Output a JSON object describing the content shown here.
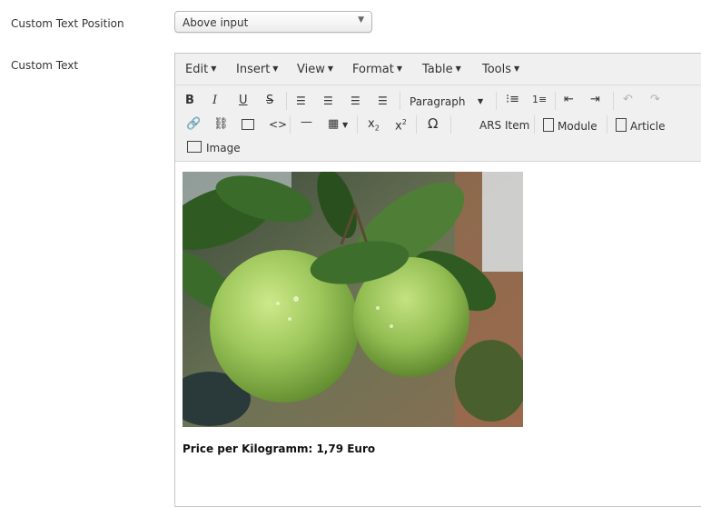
{
  "fields": {
    "position_label": "Custom Text Position",
    "position_value": "Above input",
    "text_label": "Custom Text"
  },
  "editor": {
    "menus": [
      "Edit",
      "Insert",
      "View",
      "Format",
      "Table",
      "Tools"
    ],
    "format_select": "Paragraph",
    "ars_item": "ARS Item",
    "module": "Module",
    "article": "Article",
    "image": "Image"
  },
  "content": {
    "price_text": "Price per Kilogramm: 1,79 Euro",
    "image_alt": "green apples on branch"
  },
  "colors": {
    "toolbar_bg": "#f0f0f0",
    "apple_green": "#9cc65a",
    "leaf_green": "#2f5a22"
  }
}
